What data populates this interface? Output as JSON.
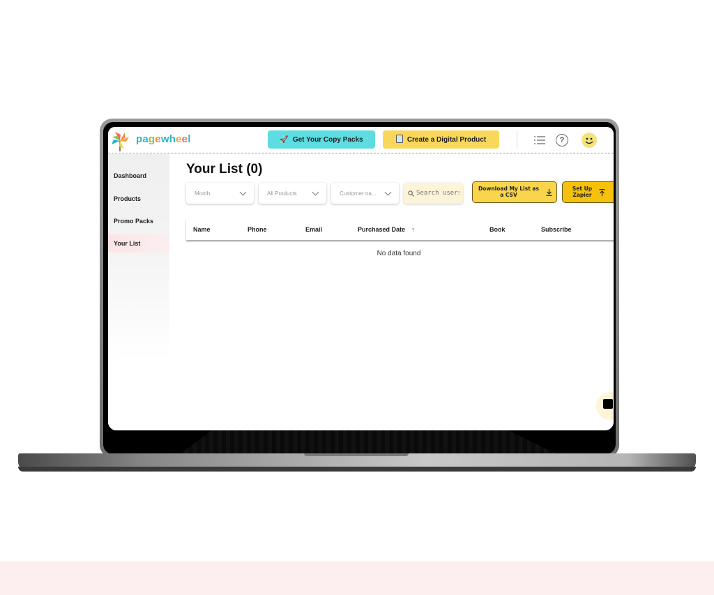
{
  "app": {
    "brand_letters": [
      {
        "ch": "p",
        "color": "#2bb5c9"
      },
      {
        "ch": "a",
        "color": "#2bb5c9"
      },
      {
        "ch": "g",
        "color": "#8bc34a"
      },
      {
        "ch": "e",
        "color": "#f28b2f"
      },
      {
        "ch": "w",
        "color": "#2bb5c9"
      },
      {
        "ch": "h",
        "color": "#2bb5c9"
      },
      {
        "ch": "e",
        "color": "#f0a33a"
      },
      {
        "ch": "e",
        "color": "#ef6a6a"
      },
      {
        "ch": "l",
        "color": "#2bb5c9"
      }
    ],
    "brand_name": "pagewheel"
  },
  "topnav": {
    "copy_packs_label": "Get Your Copy Packs",
    "copy_packs_icon": "rocket-icon",
    "digital_product_label": "Create a Digital Product",
    "digital_product_icon": "document-icon",
    "menu_icon": "list-icon",
    "help_icon": "help-icon",
    "help_glyph": "?",
    "avatar_icon": "smiley-icon",
    "accent_cyan": "#5ddde2",
    "accent_yellow": "#f9d75a"
  },
  "sidebar": {
    "items": [
      {
        "label": "Dashboard",
        "active": false
      },
      {
        "label": "Products",
        "active": false
      },
      {
        "label": "Promo Packs",
        "active": false
      },
      {
        "label": "Your List",
        "active": true
      }
    ]
  },
  "main": {
    "title": "Your List (0)",
    "filters": {
      "month": "Month",
      "products": "All Products",
      "customer": "Customer na..."
    },
    "search": {
      "placeholder": "Search users"
    },
    "download_csv_label": "Download My List as a CSV",
    "setup_zapier_label": "Set Up Zapier",
    "table": {
      "columns": [
        "Name",
        "Phone",
        "Email",
        "Purchased Date",
        "Book",
        "Subscribe"
      ],
      "sort_column": "Purchased Date",
      "sort_direction": "ascending",
      "empty_message": "No data found"
    }
  }
}
